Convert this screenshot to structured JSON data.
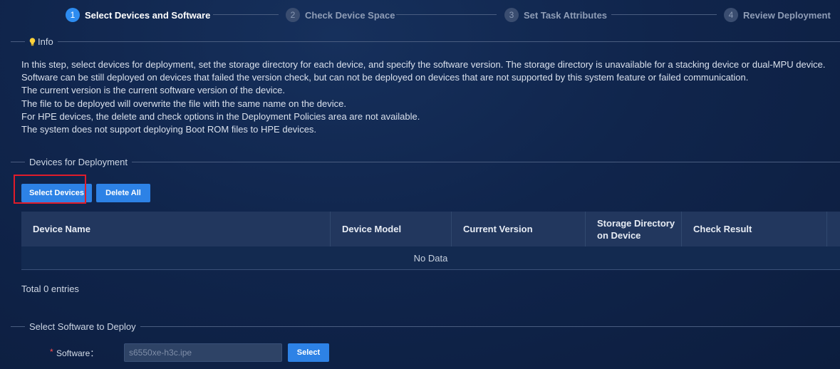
{
  "wizard": {
    "steps": [
      {
        "num": "1",
        "label": "Select Devices and Software"
      },
      {
        "num": "2",
        "label": "Check Device Space"
      },
      {
        "num": "3",
        "label": "Set Task Attributes"
      },
      {
        "num": "4",
        "label": "Review Deployment"
      }
    ],
    "active_step": 1
  },
  "info": {
    "title": "Info",
    "lines": [
      "In this step, select devices for deployment, set the storage directory for each device, and specify the software version. The storage directory is unavailable for a stacking device or dual-MPU device.",
      "Software can be still deployed on devices that failed the version check, but can not be deployed on devices that are not supported by this system feature or failed communication.",
      "The current version is the current software version of the device.",
      "The file to be deployed will overwrite the file with the same name on the device.",
      "For HPE devices, the delete and check options in the Deployment Policies area are not available.",
      "The system does not support deploying Boot ROM files to HPE devices."
    ]
  },
  "devices": {
    "title": "Devices for Deployment",
    "select_button": "Select Devices",
    "delete_all_button": "Delete All",
    "columns": [
      "Device Name",
      "Device Model",
      "Current Version",
      "Storage Directory on Device",
      "Check Result"
    ],
    "empty_text": "No Data",
    "total": "Total 0 entries"
  },
  "software": {
    "title": "Select Software to Deploy",
    "required_mark": "*",
    "label": "Software：",
    "value": "s6550xe-h3c.ipe",
    "select_button": "Select"
  },
  "colors": {
    "accent": "#2d8cf0",
    "highlight": "#e01c2a",
    "required": "#ff4d4f"
  }
}
